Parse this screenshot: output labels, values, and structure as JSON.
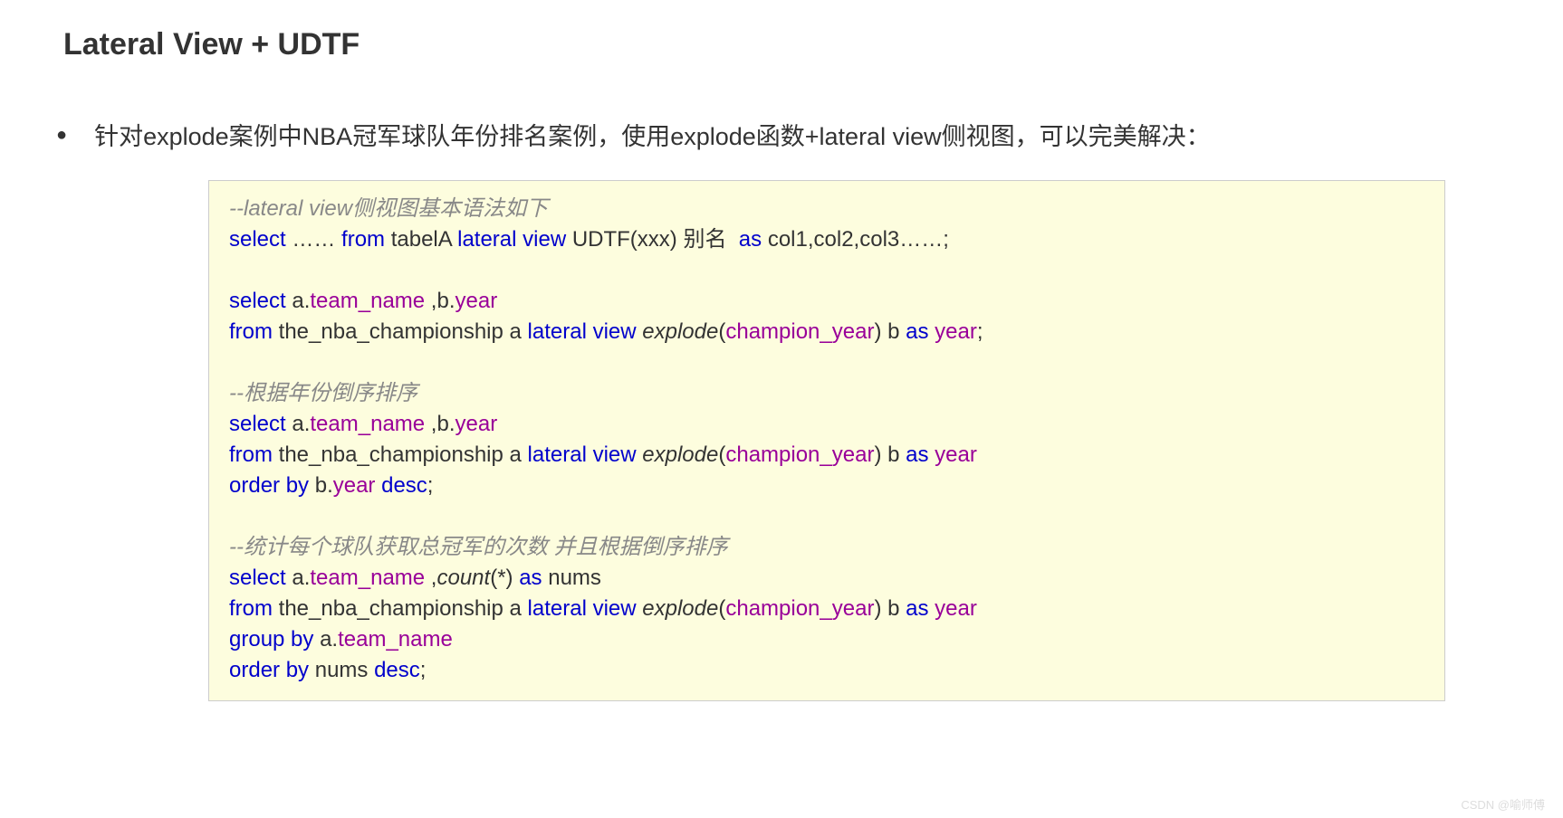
{
  "title": "Lateral View + UDTF",
  "bullet": "针对explode案例中NBA冠军球队年份排名案例，使用explode函数+lateral view侧视图，可以完美解决：",
  "code": {
    "c1": "--lateral view侧视图基本语法如下",
    "l2_select": "select",
    "l2_dots": " …… ",
    "l2_from": "from",
    "l2_tabela": " tabelA ",
    "l2_lateral": "lateral view",
    "l2_udtf": " UDTF(xxx) 别名  ",
    "l2_as": "as",
    "l2_cols": " col1,col2,col3……;",
    "l4_select": "select",
    "l4_a": " a.",
    "l4_team": "team_name",
    "l4_cb": " ,b.",
    "l4_year": "year",
    "l5_from": "from",
    "l5_tbl": " the_nba_championship a ",
    "l5_lateral": "lateral view",
    "l5_sp": " ",
    "l5_explode": "explode",
    "l5_open": "(",
    "l5_champ": "champion_year",
    "l5_close": ") b ",
    "l5_as": "as",
    "l5_sp2": " ",
    "l5_year": "year",
    "l5_semi": ";",
    "c2": "--根据年份倒序排序",
    "l8_select": "select",
    "l8_a": " a.",
    "l8_team": "team_name",
    "l8_cb": " ,b.",
    "l8_year": "year",
    "l9_from": "from",
    "l9_tbl": " the_nba_championship a ",
    "l9_lateral": "lateral view",
    "l9_sp": " ",
    "l9_explode": "explode",
    "l9_open": "(",
    "l9_champ": "champion_year",
    "l9_close": ") b ",
    "l9_as": "as",
    "l9_sp2": " ",
    "l9_year": "year",
    "l10_order": "order by",
    "l10_b": " b.",
    "l10_year": "year",
    "l10_sp": " ",
    "l10_desc": "desc",
    "l10_semi": ";",
    "c3": "--统计每个球队获取总冠军的次数 并且根据倒序排序",
    "l13_select": "select",
    "l13_a": " a.",
    "l13_team": "team_name",
    "l13_c": " ,",
    "l13_count": "count",
    "l13_paren": "(*) ",
    "l13_as": "as",
    "l13_nums": " nums",
    "l14_from": "from",
    "l14_tbl": " the_nba_championship a ",
    "l14_lateral": "lateral view",
    "l14_sp": " ",
    "l14_explode": "explode",
    "l14_open": "(",
    "l14_champ": "champion_year",
    "l14_close": ") b ",
    "l14_as": "as",
    "l14_sp2": " ",
    "l14_year": "year",
    "l15_group": "group by",
    "l15_a": " a.",
    "l15_team": "team_name",
    "l16_order": "order by",
    "l16_nums": " nums ",
    "l16_desc": "desc",
    "l16_semi": ";"
  },
  "watermark": "CSDN @喻师傅"
}
